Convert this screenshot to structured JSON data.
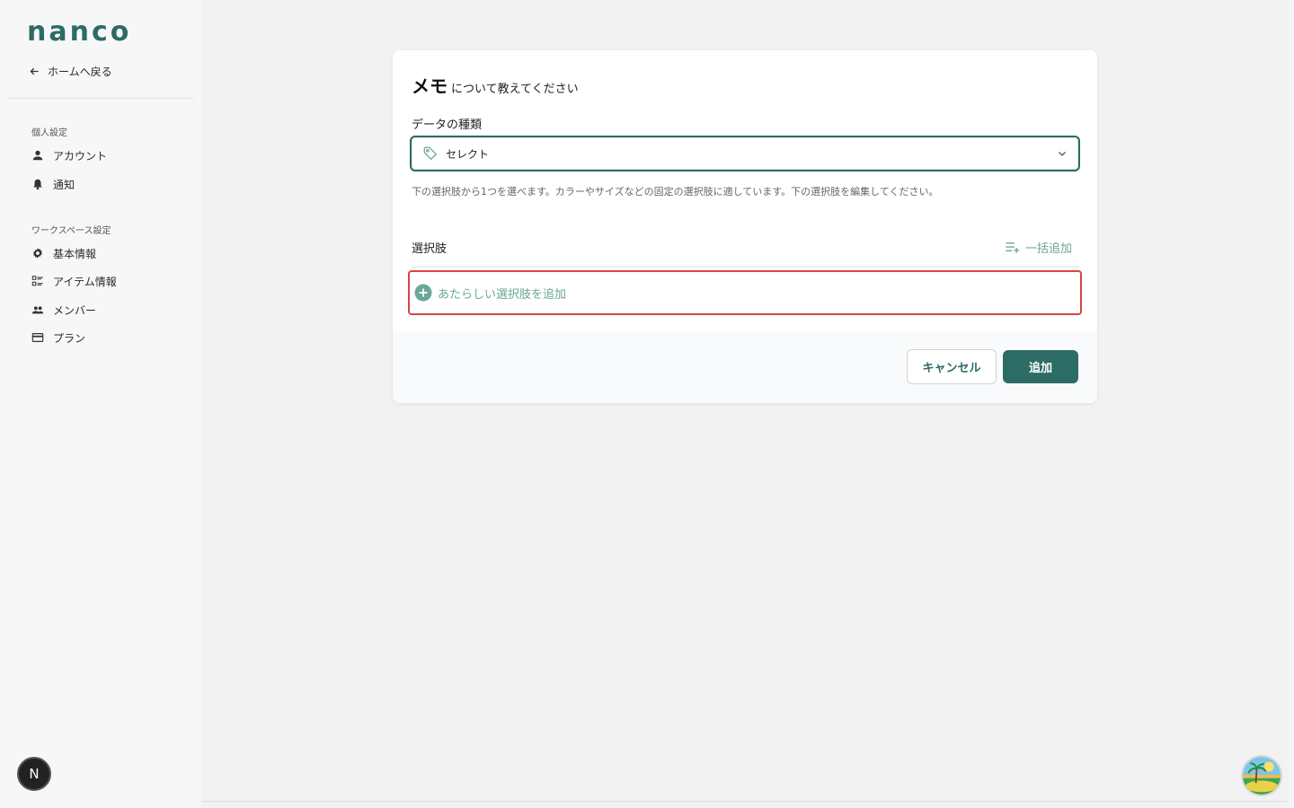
{
  "brand": {
    "logo_text": "nanco",
    "color": "#2d6b66"
  },
  "sidebar": {
    "back_label": "ホームへ戻る",
    "sections": [
      {
        "label": "個人設定",
        "items": [
          {
            "label": "アカウント",
            "icon": "person-icon"
          },
          {
            "label": "通知",
            "icon": "bell-icon"
          }
        ]
      },
      {
        "label": "ワークスペース設定",
        "items": [
          {
            "label": "基本情報",
            "icon": "gear-icon"
          },
          {
            "label": "アイテム情報",
            "icon": "list-icon"
          },
          {
            "label": "メンバー",
            "icon": "people-icon"
          },
          {
            "label": "プラン",
            "icon": "card-icon"
          }
        ]
      }
    ],
    "avatar_letter": "N"
  },
  "dialog": {
    "title_main": "メモ",
    "title_sub": "について教えてください",
    "field_label": "データの種類",
    "select_value": "セレクト",
    "help_text": "下の選択肢から1つを選べます。カラーやサイズなどの固定の選択肢に適しています。下の選択肢を編集してください。",
    "options_title": "選択肢",
    "bulk_add_label": "一括追加",
    "add_option_label": "あたらしい選択肢を追加",
    "cancel_label": "キャンセル",
    "submit_label": "追加"
  },
  "colors": {
    "accent": "#2d6b66",
    "accent_light": "#6aa79a",
    "error_border": "#d94444"
  }
}
